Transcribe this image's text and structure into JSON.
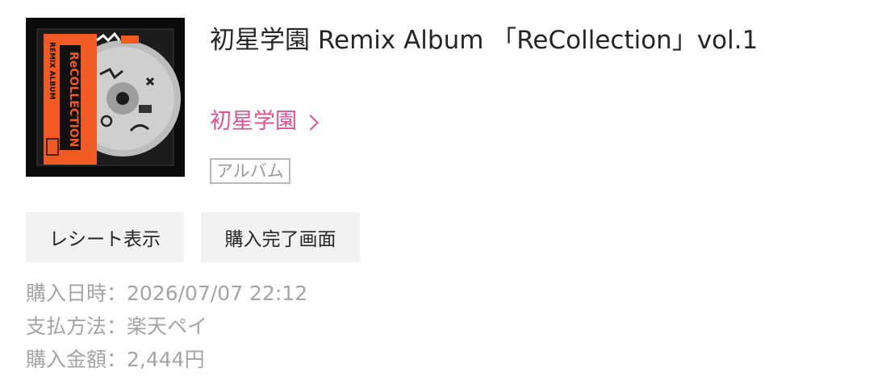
{
  "album": {
    "title": "初星学園 Remix Album 「ReCollection」vol.1",
    "artist": "初星学園",
    "type_badge": "アルバム",
    "cover_icon": "album-cover-art",
    "cover_text": "REMIX ALBUM ReCOLLECTION"
  },
  "actions": {
    "receipt_label": "レシート表示",
    "purchase_complete_label": "購入完了画面"
  },
  "purchase_info": {
    "date_label": "購入日時：",
    "date_value": "2026/07/07 22:12",
    "payment_label": "支払方法：",
    "payment_value": "楽天ペイ",
    "amount_label": "購入金額：",
    "amount_value": "2,444円"
  },
  "colors": {
    "artist_link": "#e2508f",
    "muted_text": "#a4a4a4",
    "button_bg": "#f2f2f2",
    "cover_accent": "#f15a22"
  }
}
